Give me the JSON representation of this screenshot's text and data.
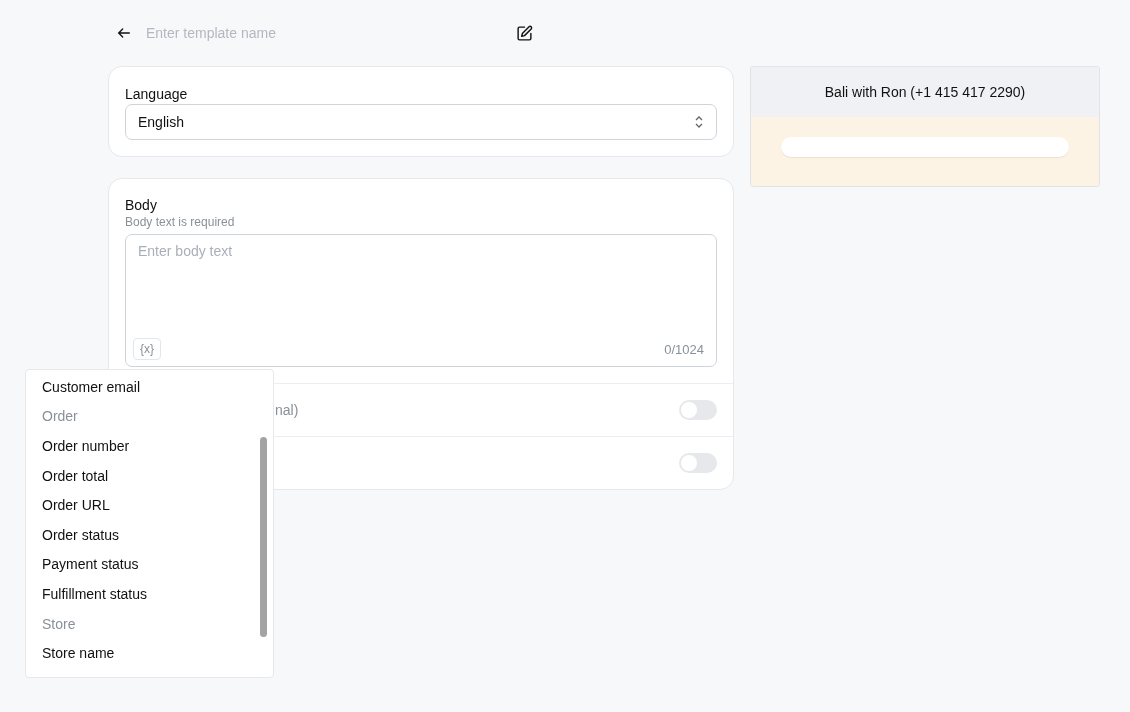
{
  "header": {
    "template_name": {
      "placeholder": "Enter template name"
    }
  },
  "language": {
    "label": "Language",
    "value": "English"
  },
  "body": {
    "label": "Body",
    "hint": "Body text is required",
    "placeholder": "Enter body text",
    "variable_button": "{x}",
    "counter": "0/1024"
  },
  "toggle_rows": [
    {
      "label": "nal)",
      "on": false
    },
    {
      "on": false
    }
  ],
  "variable_menu": [
    {
      "kind": "item",
      "text": "Customer email"
    },
    {
      "kind": "group",
      "text": "Order"
    },
    {
      "kind": "item",
      "text": "Order number"
    },
    {
      "kind": "item",
      "text": "Order total"
    },
    {
      "kind": "item",
      "text": "Order URL"
    },
    {
      "kind": "item",
      "text": "Order status"
    },
    {
      "kind": "item",
      "text": "Payment status"
    },
    {
      "kind": "item",
      "text": "Fulfillment status"
    },
    {
      "kind": "group",
      "text": "Store"
    },
    {
      "kind": "item",
      "text": "Store name"
    }
  ],
  "preview": {
    "title": "Bali with Ron (+1 415 417 2290)"
  }
}
